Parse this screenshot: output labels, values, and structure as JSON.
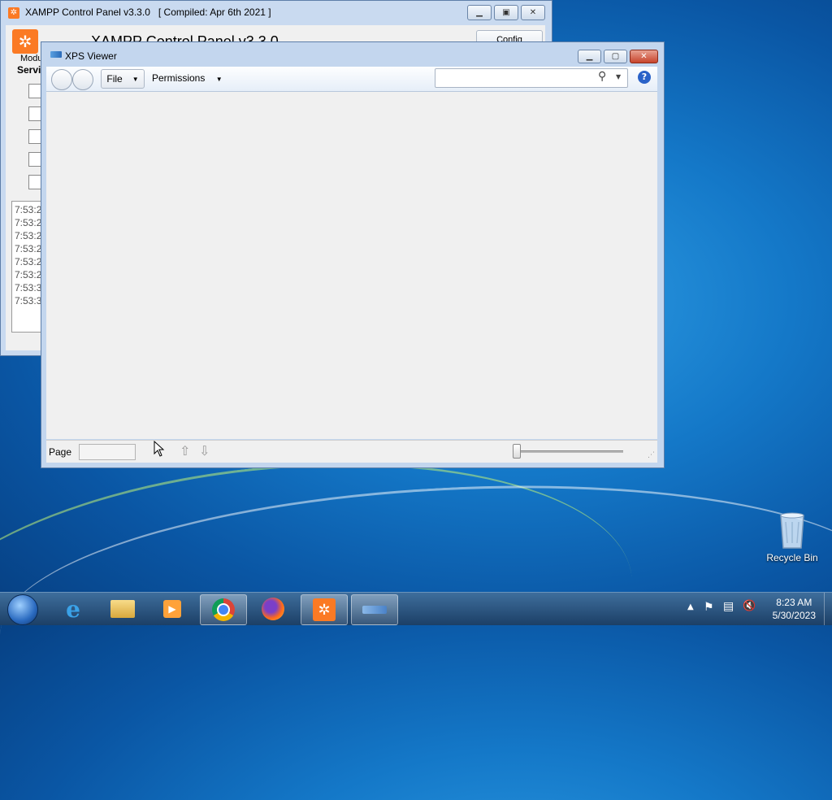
{
  "xampp": {
    "title": "XAMPP Control Panel v3.3.0   [ Compiled: Apr 6th 2021 ]",
    "header": "XAMPP Control Panel v3.3.0",
    "config_label": "Config",
    "modules_label": "Modu",
    "service_label": "Servi",
    "log_lines": [
      "7:53:2",
      "7:53:2",
      "7:53:2",
      "7:53:2",
      "7:53:2",
      "7:53:2",
      "7:53:3",
      "7:53:3"
    ]
  },
  "xps": {
    "title": "XPS Viewer",
    "menu_file": "File",
    "menu_permissions": "Permissions",
    "search_placeholder": "",
    "page_label": "Page",
    "page_value": "",
    "help_glyph": "?"
  },
  "desktop": {
    "recycle_bin_label": "Recycle Bin"
  },
  "taskbar": {
    "time": "8:23 AM",
    "date": "5/30/2023"
  },
  "colors": {
    "xampp_orange": "#fb7a24",
    "help_blue": "#2a62c8",
    "close_red": "#c7452c"
  },
  "icons": [
    "start-orb-icon",
    "internet-explorer-icon",
    "file-explorer-icon",
    "media-player-icon",
    "chrome-icon",
    "firefox-icon",
    "xampp-icon",
    "xps-viewer-icon",
    "recycle-bin-icon",
    "search-icon",
    "help-icon",
    "up-arrow-icon",
    "down-arrow-icon",
    "action-center-flag-icon",
    "network-icon",
    "volume-muted-icon"
  ]
}
